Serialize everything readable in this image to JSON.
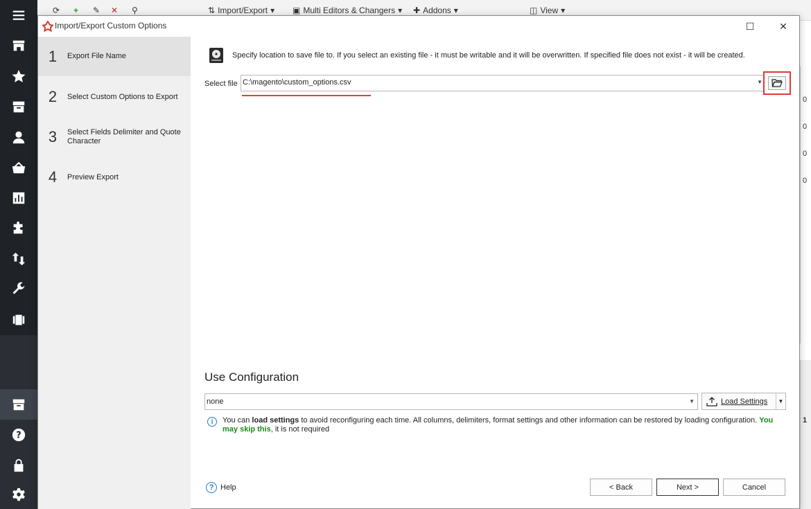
{
  "toolbar": {
    "import_export": "Import/Export",
    "multi_editors": "Multi Editors & Changers",
    "addons": "Addons",
    "view": "View"
  },
  "background_grid": {
    "cells": [
      "0",
      "0",
      "0",
      "0",
      "1"
    ]
  },
  "dialog": {
    "title": "Import/Export Custom Options",
    "steps": [
      {
        "num": "1",
        "label": "Export File Name"
      },
      {
        "num": "2",
        "label": "Select Custom Options to Export"
      },
      {
        "num": "3",
        "label": "Select Fields Delimiter and Quote Character"
      },
      {
        "num": "4",
        "label": "Preview Export"
      }
    ],
    "hint": "Specify location to save file to. If you select an existing file - it must be writable and it will be overwritten. If specified file does not exist - it will be created.",
    "select_file_label": "Select file",
    "file_path": "C:\\magento\\custom_options.csv",
    "use_configuration_heading": "Use Configuration",
    "config_value": "none",
    "load_settings_label": "Load Settings",
    "info": {
      "part1": "You can ",
      "bold": "load settings",
      "part2": " to avoid reconfiguring each time. All columns, delimiters, format settings and other information can be restored by loading configuration. ",
      "green": "You may skip this",
      "part3": ", it is not required"
    },
    "help_label": "Help",
    "back_label": "< Back",
    "next_label": "Next >",
    "cancel_label": "Cancel"
  },
  "icons": [
    "menu-icon",
    "store-icon",
    "star-icon",
    "inbox-icon",
    "user-icon",
    "basket-icon",
    "chart-icon",
    "puzzle-icon",
    "transfer-icon",
    "wrench-icon",
    "film-icon",
    "archive-icon",
    "question-icon",
    "lock-icon",
    "gear-icon"
  ],
  "colors": {
    "sidebar": "#1f2328",
    "highlight_red": "#e03838",
    "info_blue": "#1e7bd0",
    "skip_green": "#1a8a1a"
  }
}
